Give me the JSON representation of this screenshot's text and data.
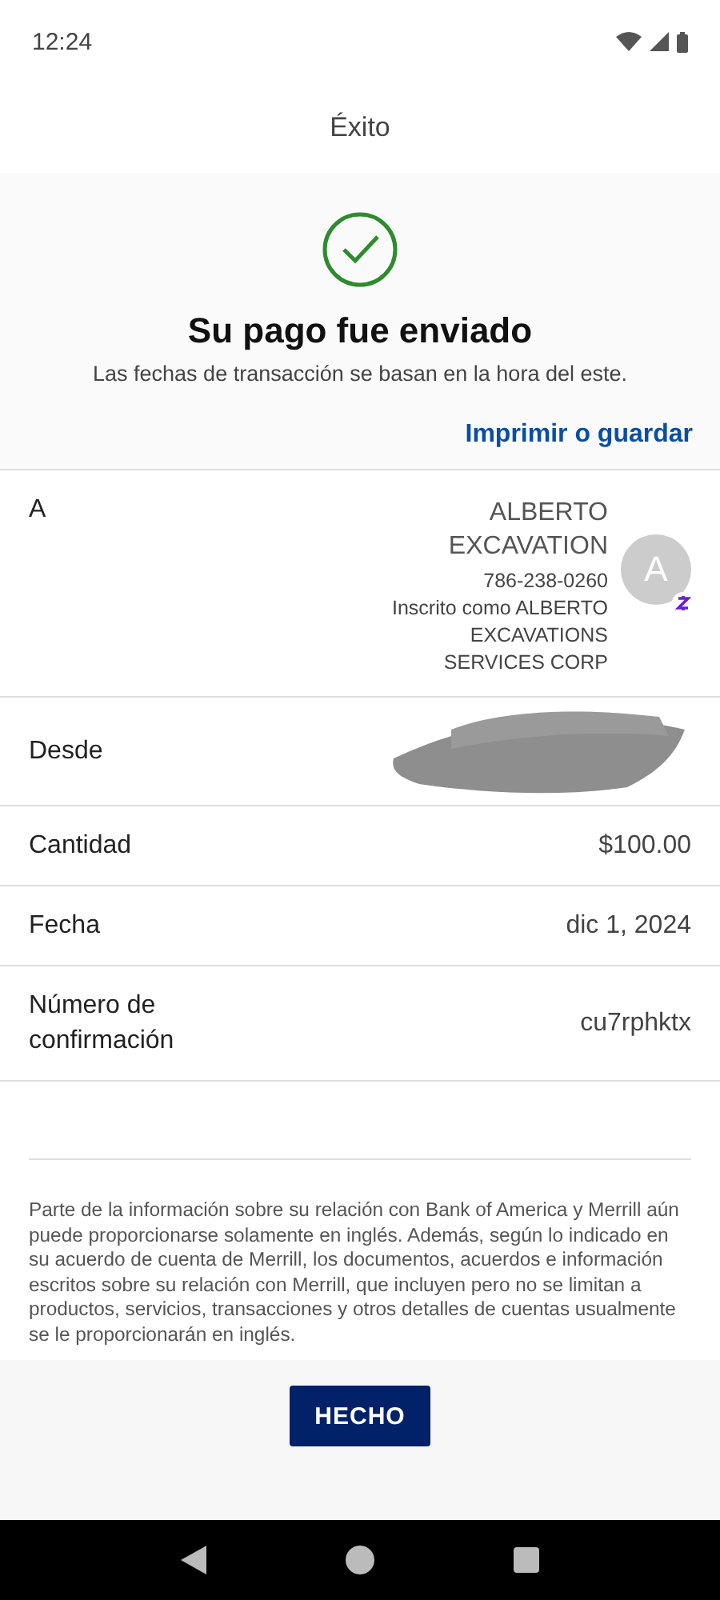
{
  "status_bar": {
    "time": "12:24"
  },
  "header": {
    "title": "Éxito"
  },
  "success": {
    "heading": "Su pago fue enviado",
    "subtitle": "Las fechas de transacción se basan en la hora del este.",
    "print_link": "Imprimir o guardar"
  },
  "details": [
    {
      "kind": "recipient",
      "label": "A",
      "name": "ALBERTO EXCAVATION",
      "phone": "786-238-0260",
      "enrolled": "Inscrito como ALBERTO EXCAVATIONS SERVICES CORP",
      "avatar": "A"
    },
    {
      "kind": "redacted",
      "label": "Desde"
    },
    {
      "kind": "text",
      "label": "Cantidad",
      "value": "$100.00"
    },
    {
      "kind": "text",
      "label": "Fecha",
      "value": "dic 1, 2024"
    },
    {
      "kind": "text",
      "label": "Número de confirmación",
      "value": "cu7rphktx"
    }
  ],
  "disclaimer": "Parte de la información sobre su relación con Bank of America y Merrill aún puede proporcionarse solamente en inglés. Además, según lo indicado en su acuerdo de cuenta de Merrill, los documentos, acuerdos e información escritos sobre su relación con Merrill, que incluyen pero no se limitan a productos, servicios, transacciones y otros detalles de cuentas usualmente se le proporcionarán en inglés.",
  "done_button": "HECHO"
}
